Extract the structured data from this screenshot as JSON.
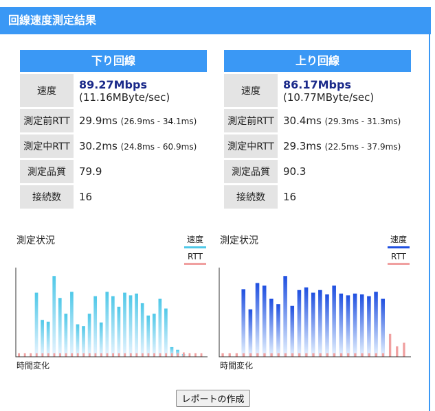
{
  "header": {
    "title": "回線速度測定結果"
  },
  "download": {
    "title": "下り回線",
    "speed_label": "速度",
    "speed": "89.27Mbps",
    "speed_bytes": "(11.16MByte/sec)",
    "rtt_before_label": "測定前RTT",
    "rtt_before": "29.9ms",
    "rtt_before_range": "(26.9ms - 34.1ms)",
    "rtt_during_label": "測定中RTT",
    "rtt_during": "30.2ms",
    "rtt_during_range": "(24.8ms - 60.9ms)",
    "quality_label": "測定品質",
    "quality": "79.9",
    "connections_label": "接続数",
    "connections": "16"
  },
  "upload": {
    "title": "上り回線",
    "speed_label": "速度",
    "speed": "86.17Mbps",
    "speed_bytes": "(10.77MByte/sec)",
    "rtt_before_label": "測定前RTT",
    "rtt_before": "30.4ms",
    "rtt_before_range": "(29.3ms - 31.3ms)",
    "rtt_during_label": "測定中RTT",
    "rtt_during": "29.3ms",
    "rtt_during_range": "(22.5ms - 37.9ms)",
    "quality_label": "測定品質",
    "quality": "90.3",
    "connections_label": "接続数",
    "connections": "16"
  },
  "charts": [
    {
      "title": "測定状況",
      "legend_speed": "速度",
      "legend_rtt": "RTT",
      "xlabel": "時間変化",
      "speed_color": "#4fc8e8",
      "rtt_color": "#f0a0a0",
      "speed_values": [
        0,
        0,
        0,
        0.73,
        0.42,
        0.4,
        0.92,
        0.67,
        0.49,
        0.74,
        0.37,
        0.35,
        0.49,
        0.69,
        0.39,
        0.74,
        0.69,
        0.57,
        0.73,
        0.7,
        0.72,
        0.61,
        0.47,
        0.49,
        0.66,
        0.55,
        0.11,
        0.08,
        0.03,
        0,
        0,
        0
      ],
      "rtt_values": [
        0.04,
        0.04,
        0.04,
        0.04,
        0.04,
        0.04,
        0.04,
        0.04,
        0.04,
        0.04,
        0.04,
        0.04,
        0.04,
        0.04,
        0.04,
        0.04,
        0.04,
        0.04,
        0.04,
        0.04,
        0.04,
        0.04,
        0.04,
        0.04,
        0.04,
        0.04,
        0.04,
        0.04,
        0.05,
        0.04,
        0.04,
        0.04
      ]
    },
    {
      "title": "測定状況",
      "legend_speed": "速度",
      "legend_rtt": "RTT",
      "xlabel": "時間変化",
      "speed_color": "#1f4fe0",
      "rtt_color": "#f0a0a0",
      "speed_values": [
        0,
        0,
        0,
        0.77,
        0.54,
        0.84,
        0.81,
        0.66,
        0.6,
        0.92,
        0.58,
        0.76,
        0.79,
        0.73,
        0.76,
        0.71,
        0.81,
        0.72,
        0.7,
        0.72,
        0.71,
        0.69,
        0.74,
        0.66,
        0,
        0,
        0
      ],
      "rtt_values": [
        0.04,
        0.04,
        0.04,
        0.04,
        0.04,
        0.04,
        0.04,
        0.04,
        0.04,
        0.04,
        0.04,
        0.04,
        0.04,
        0.04,
        0.04,
        0.04,
        0.04,
        0.04,
        0.04,
        0.04,
        0.04,
        0.04,
        0.04,
        0.04,
        0.26,
        0.12,
        0.16
      ]
    }
  ],
  "report_button": "レポートの作成"
}
